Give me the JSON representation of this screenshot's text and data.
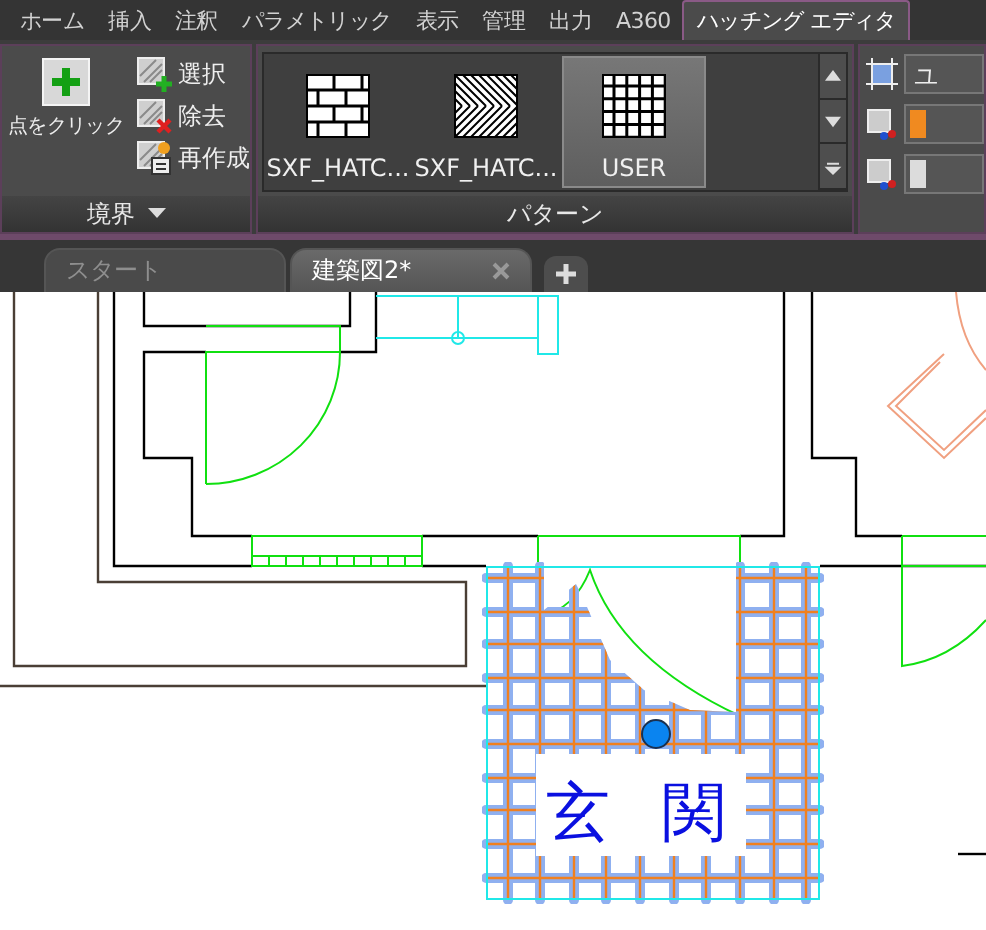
{
  "ribbon_tabs": [
    {
      "label": "ホーム",
      "selected": false
    },
    {
      "label": "挿入",
      "selected": false
    },
    {
      "label": "注釈",
      "selected": false
    },
    {
      "label": "パラメトリック",
      "selected": false
    },
    {
      "label": "表示",
      "selected": false
    },
    {
      "label": "管理",
      "selected": false
    },
    {
      "label": "出力",
      "selected": false
    },
    {
      "label": "A360",
      "selected": false
    },
    {
      "label": "ハッチング エディタ",
      "selected": true
    }
  ],
  "boundary_panel": {
    "title": "境界",
    "pick_button": "点をクリック",
    "buttons": [
      {
        "label": "選択",
        "kind": "add"
      },
      {
        "label": "除去",
        "kind": "remove"
      },
      {
        "label": "再作成",
        "kind": "recreate"
      }
    ]
  },
  "pattern_panel": {
    "title": "パターン",
    "items": [
      {
        "label": "SXF_HATC...",
        "kind": "brick",
        "selected": false
      },
      {
        "label": "SXF_HATC...",
        "kind": "herringbone",
        "selected": false
      },
      {
        "label": "USER",
        "kind": "grid",
        "selected": true
      }
    ]
  },
  "properties_panel": {
    "type_field": "ユ"
  },
  "file_tabs": [
    {
      "label": "スタート",
      "selected": false,
      "closable": false
    },
    {
      "label": "建築図2*",
      "selected": true,
      "closable": true
    }
  ],
  "drawing": {
    "room_label": "玄関"
  }
}
